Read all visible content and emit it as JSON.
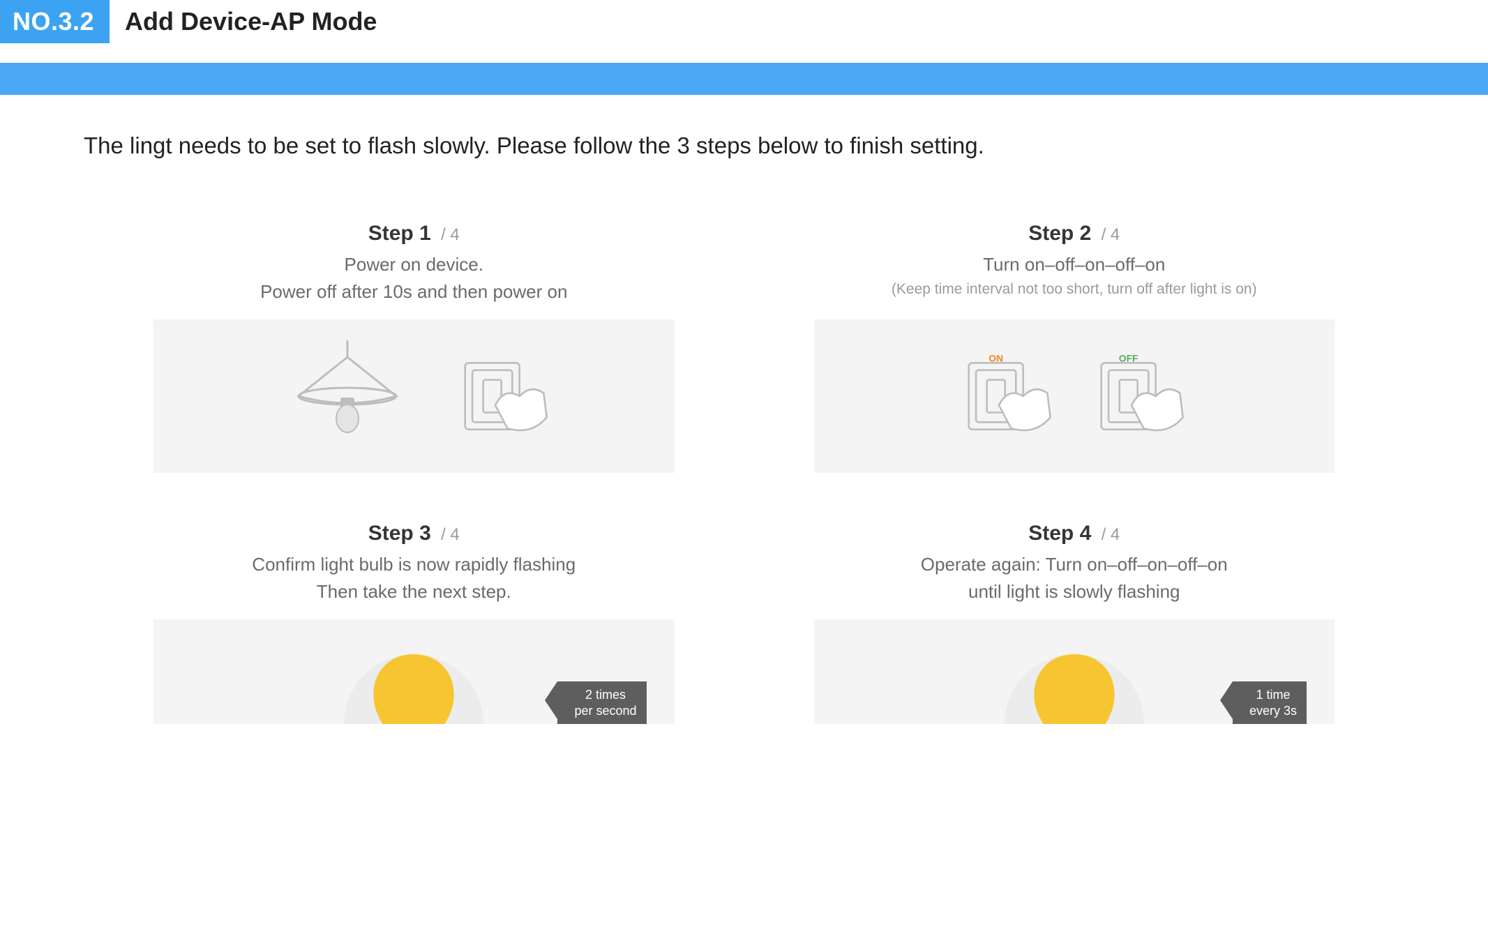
{
  "header": {
    "badge": "NO.3.2",
    "title": "Add Device-AP Mode"
  },
  "intro": "The lingt needs to be set to flash slowly. Please follow the 3 steps below to finish setting.",
  "steps": [
    {
      "label": "Step 1",
      "of": "/ 4",
      "line1": "Power on device.",
      "line2": "Power off after 10s and then power on"
    },
    {
      "label": "Step 2",
      "of": "/ 4",
      "line1": "Turn on–off–on–off–on",
      "line2": "(Keep time interval not too short, turn off after light is on)",
      "switch_on": "ON",
      "switch_off": "OFF"
    },
    {
      "label": "Step 3",
      "of": "/ 4",
      "line1": "Confirm light bulb is now rapidly flashing",
      "line2": "Then take the next step.",
      "tag_line1": "2 times",
      "tag_line2": "per second"
    },
    {
      "label": "Step 4",
      "of": "/ 4",
      "line1": "Operate again: Turn on–off–on–off–on",
      "line2": "until light is slowly flashing",
      "tag_line1": "1 time",
      "tag_line2": "every 3s"
    }
  ]
}
